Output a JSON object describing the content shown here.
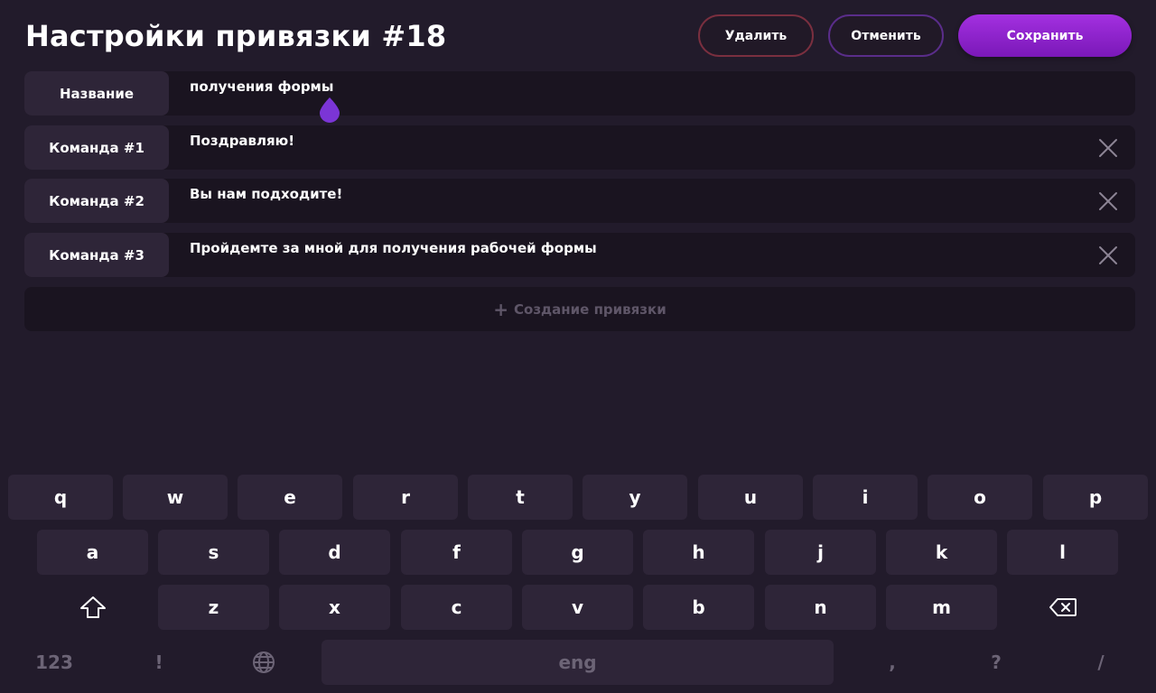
{
  "header": {
    "title": "Настройки привязки #18",
    "delete_label": "Удалить",
    "cancel_label": "Отменить",
    "save_label": "Сохранить"
  },
  "rows": [
    {
      "label": "Название",
      "value": "получения формы",
      "removable": false
    },
    {
      "label": "Команда #1",
      "value": "Поздравляю!",
      "removable": true
    },
    {
      "label": "Команда #2",
      "value": "Вы нам подходите!",
      "removable": true
    },
    {
      "label": "Команда #3",
      "value": "Пройдемте за мной для получения рабочей формы",
      "removable": true
    }
  ],
  "add_binding": {
    "label": "Создание привязки",
    "icon": "plus-icon"
  },
  "keyboard": {
    "row1": [
      "q",
      "w",
      "e",
      "r",
      "t",
      "y",
      "u",
      "i",
      "o",
      "p"
    ],
    "row2": [
      "a",
      "s",
      "d",
      "f",
      "g",
      "h",
      "j",
      "k",
      "l"
    ],
    "row3": [
      "z",
      "x",
      "c",
      "v",
      "b",
      "n",
      "m"
    ],
    "shift_icon": "shift-icon",
    "backspace_icon": "backspace-icon",
    "numbers_label": "123",
    "exclaim_label": "!",
    "globe_icon": "globe-icon",
    "space_label": "eng",
    "comma_label": ",",
    "question_label": "?",
    "slash_label": "/"
  },
  "colors": {
    "background": "#221b2b",
    "accent": "#a330e0",
    "danger_border": "#7a2f3f",
    "cancel_border": "#5a2d8a"
  }
}
